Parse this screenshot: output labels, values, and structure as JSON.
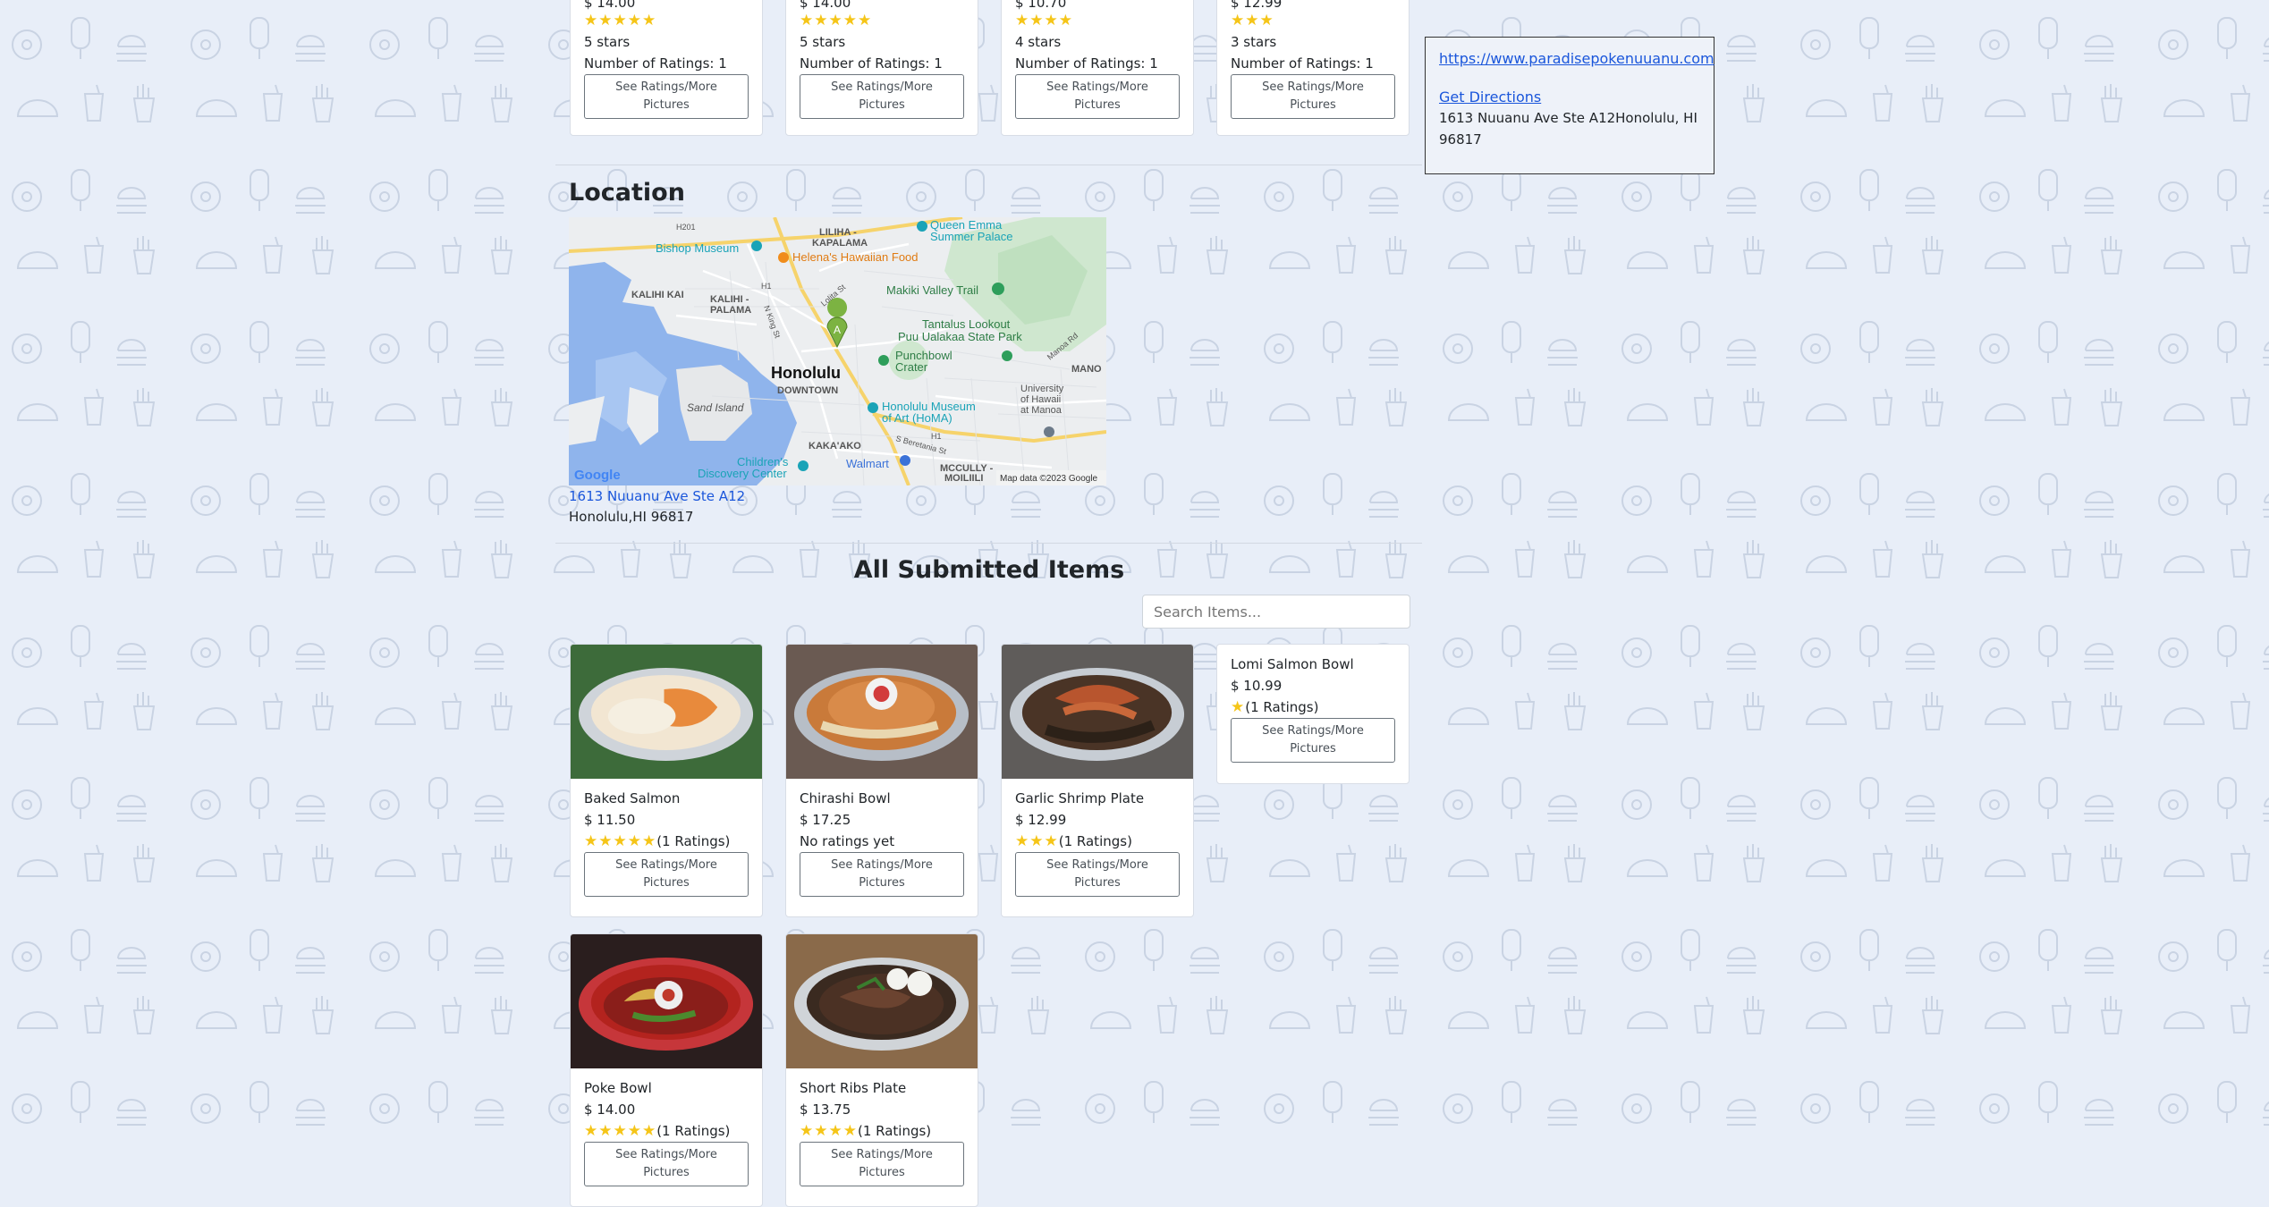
{
  "top_items": [
    {
      "price_partial": "$ 14.00",
      "stars": 5,
      "rating_text": "5 stars",
      "num_ratings": "Number of Ratings: 1",
      "button": "See Ratings/More Pictures"
    },
    {
      "price_partial": "$ 14.00",
      "stars": 5,
      "rating_text": "5 stars",
      "num_ratings": "Number of Ratings: 1",
      "button": "See Ratings/More Pictures"
    },
    {
      "price_partial": "$ 10.70",
      "stars": 4,
      "rating_text": "4 stars",
      "num_ratings": "Number of Ratings: 1",
      "button": "See Ratings/More Pictures"
    },
    {
      "price_partial": "$ 12.99",
      "stars": 3,
      "rating_text": "3 stars",
      "num_ratings": "Number of Ratings: 1",
      "button": "See Ratings/More Pictures"
    }
  ],
  "info_box": {
    "website": "https://www.paradisepokenuuanu.com",
    "directions": "Get Directions",
    "address_line1": "1613 Nuuanu Ave Ste A12Honolulu, HI",
    "address_line2": "96817"
  },
  "location": {
    "heading": "Location",
    "address_link": "1613 Nuuanu Ave Ste A12",
    "city_line": "Honolulu,HI 96817",
    "map": {
      "labels": {
        "liliha": "LILIHA -",
        "kapalama": "KAPALAMA",
        "bishop": "Bishop Museum",
        "queen_emma": "Queen Emma",
        "summer_palace": "Summer Palace",
        "helenas": "Helena's Hawaiian Food",
        "kalihi_kai": "KALIHI KAI",
        "kalihi": "KALIHI -",
        "palama": "PALAMA",
        "makiki": "Makiki Valley Trail",
        "tantalus": "Tantalus Lookout",
        "puu": "Puu Ualakaa State Park",
        "punchbowl": "Punchbowl",
        "crater": "Crater",
        "honolulu": "Honolulu",
        "downtown": "DOWNTOWN",
        "sand_island": "Sand Island",
        "museum": "Honolulu Museum",
        "of_art": "of Art (HoMA)",
        "university": "University",
        "of_hawaii": "of Hawaii",
        "at_manoa": "at Manoa",
        "mano": "MANO",
        "kakaako": "KAKA'AKO",
        "childrens": "Children's",
        "discovery": "Discovery Center",
        "walmart": "Walmart",
        "mccully": "MCCULLY -",
        "moiliili": "MOILIILI",
        "pin": "A",
        "google": "Google",
        "attribution": "Map data ©2023 Google",
        "h201": "H201",
        "h1": "H1",
        "h1b": "H1",
        "king_st": "N King St",
        "lolita": "Lolita St",
        "beretania": "S Beretania St",
        "manoa_rd": "Manoa Rd"
      }
    }
  },
  "submitted": {
    "heading": "All Submitted Items",
    "search_placeholder": "Search Items...",
    "items": [
      {
        "name": "Baked Salmon",
        "price": "$ 11.50",
        "stars": 5,
        "ratings": "(1 Ratings)",
        "button": "See Ratings/More Pictures",
        "photo": "baked-salmon"
      },
      {
        "name": "Chirashi Bowl",
        "price": "$ 17.25",
        "stars": 0,
        "ratings": "No ratings yet",
        "button": "See Ratings/More Pictures",
        "photo": "chirashi-bowl"
      },
      {
        "name": "Garlic Shrimp Plate",
        "price": "$ 12.99",
        "stars": 3,
        "ratings": "(1 Ratings)",
        "button": "See Ratings/More Pictures",
        "photo": "garlic-shrimp"
      },
      {
        "name": "Lomi Salmon Bowl",
        "price": "$ 10.99",
        "stars": 1,
        "ratings": "(1 Ratings)",
        "button": "See Ratings/More Pictures",
        "photo": ""
      },
      {
        "name": "Poke Bowl",
        "price": "$ 14.00",
        "stars": 5,
        "ratings": "(1 Ratings)",
        "button": "See Ratings/More Pictures",
        "photo": "poke-bowl"
      },
      {
        "name": "Short Ribs Plate",
        "price": "$ 13.75",
        "stars": 4,
        "ratings": "(1 Ratings)",
        "button": "See Ratings/More Pictures",
        "photo": "short-ribs"
      }
    ]
  },
  "colors": {
    "star": "#f5c518",
    "link": "#1a56db",
    "background": "#e8eef8"
  }
}
